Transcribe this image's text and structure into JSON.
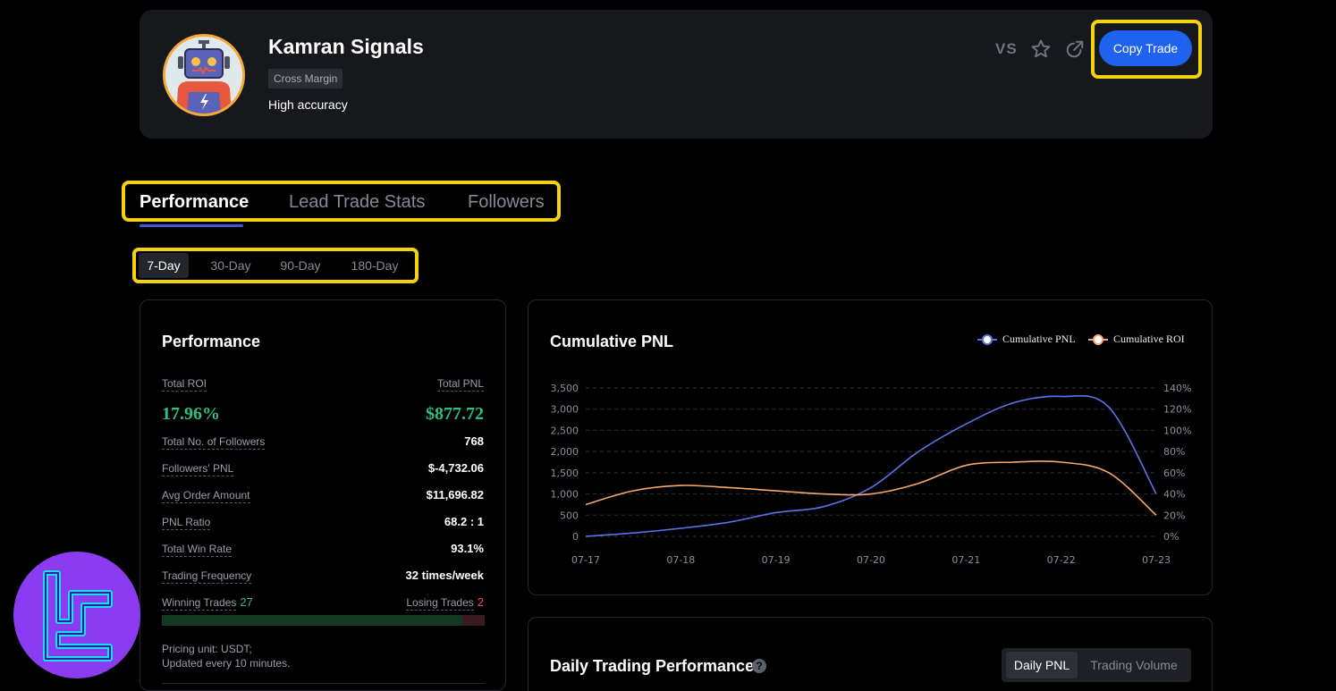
{
  "trader": {
    "name": "Kamran Signals",
    "margin_mode": "Cross Margin",
    "description": "High accuracy"
  },
  "header_actions": {
    "vs_label": "VS",
    "star_icon": "star-icon",
    "share_icon": "external-share-icon",
    "copy_trade_label": "Copy Trade"
  },
  "tabs": [
    {
      "label": "Performance",
      "active": true
    },
    {
      "label": "Lead Trade Stats",
      "active": false
    },
    {
      "label": "Followers",
      "active": false
    }
  ],
  "ranges": [
    {
      "label": "7-Day",
      "active": true
    },
    {
      "label": "30-Day",
      "active": false
    },
    {
      "label": "90-Day",
      "active": false
    },
    {
      "label": "180-Day",
      "active": false
    }
  ],
  "performance": {
    "title": "Performance",
    "total_roi_label": "Total ROI",
    "total_roi_value": "17.96%",
    "total_pnl_label": "Total PNL",
    "total_pnl_value": "$877.72",
    "rows": [
      {
        "label": "Total No. of Followers",
        "value": "768"
      },
      {
        "label": "Followers' PNL",
        "value": "$-4,732.06"
      },
      {
        "label": "Avg Order Amount",
        "value": "$11,696.82"
      },
      {
        "label": "PNL Ratio",
        "value": "68.2 : 1"
      },
      {
        "label": "Total Win Rate",
        "value": "93.1%"
      },
      {
        "label": "Trading Frequency",
        "value": "32 times/week"
      }
    ],
    "winning_trades_label": "Winning Trades",
    "winning_trades_value": "27",
    "losing_trades_label": "Losing Trades",
    "losing_trades_value": "2",
    "win_fraction": 0.931,
    "pricing_unit": "Pricing unit: USDT;",
    "update_note": "Updated every 10 minutes."
  },
  "chart_card": {
    "title": "Cumulative PNL"
  },
  "chart_data": {
    "type": "line",
    "title": "Cumulative PNL",
    "x": [
      "07-17",
      "07-18",
      "07-19",
      "07-20",
      "07-21",
      "07-22",
      "07-23"
    ],
    "series": [
      {
        "name": "Cumulative PNL",
        "axis": "left",
        "color": "#5b74e8",
        "x": [
          0,
          0.5,
          1,
          1.5,
          2,
          2.5,
          3,
          3.5,
          4,
          4.5,
          5,
          5.5,
          6
        ],
        "values": [
          0,
          80,
          190,
          330,
          560,
          700,
          1150,
          2000,
          2650,
          3150,
          3300,
          3050,
          1000
        ]
      },
      {
        "name": "Cumulative ROI",
        "axis": "right",
        "color": "#f6a86a",
        "x": [
          0,
          0.5,
          1,
          1.5,
          2,
          2.5,
          3,
          3.5,
          4,
          4.5,
          5,
          5.5,
          6
        ],
        "values": [
          30,
          43,
          48,
          46,
          43,
          40,
          40,
          50,
          67,
          70,
          70,
          60,
          20
        ]
      }
    ],
    "y_left": {
      "min": 0,
      "max": 3500,
      "ticks": [
        "0",
        "500",
        "1,000",
        "1,500",
        "2,000",
        "2,500",
        "3,000",
        "3,500"
      ]
    },
    "y_right": {
      "min": 0,
      "max": 140,
      "ticks": [
        "0%",
        "20%",
        "40%",
        "60%",
        "80%",
        "100%",
        "120%",
        "140%"
      ]
    },
    "grid": true,
    "legend": "top-right"
  },
  "daily": {
    "title": "Daily Trading Performance",
    "help_icon": "?",
    "toggle": [
      {
        "label": "Daily PNL",
        "active": true
      },
      {
        "label": "Trading Volume",
        "active": false
      }
    ]
  },
  "brand": {
    "logo_color": "#8b3cf0",
    "logo_icon": "tc-monogram-logo"
  }
}
